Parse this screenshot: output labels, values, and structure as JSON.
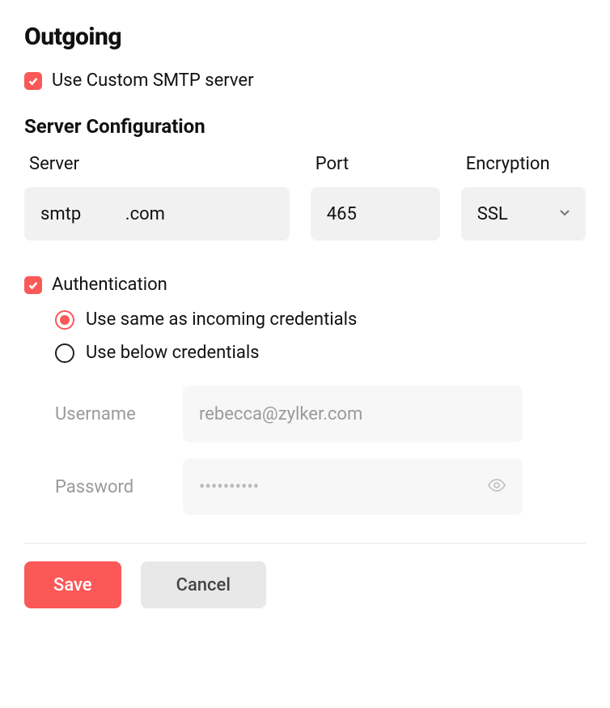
{
  "outgoing": {
    "title": "Outgoing",
    "use_custom_smtp": {
      "checked": true,
      "label": "Use Custom SMTP server"
    }
  },
  "server_config": {
    "title": "Server Configuration",
    "server": {
      "label": "Server",
      "value": "smtp          .com"
    },
    "port": {
      "label": "Port",
      "value": "465"
    },
    "encryption": {
      "label": "Encryption",
      "value": "SSL"
    }
  },
  "auth": {
    "checked": true,
    "label": "Authentication",
    "radios": {
      "same": {
        "label": "Use same as incoming credentials",
        "selected": true
      },
      "below": {
        "label": "Use below credentials",
        "selected": false
      }
    },
    "username": {
      "label": "Username",
      "value": "rebecca@zylker.com"
    },
    "password": {
      "label": "Password",
      "placeholder": "••••••••••"
    }
  },
  "buttons": {
    "save": "Save",
    "cancel": "Cancel"
  },
  "colors": {
    "accent": "#fb5858"
  }
}
